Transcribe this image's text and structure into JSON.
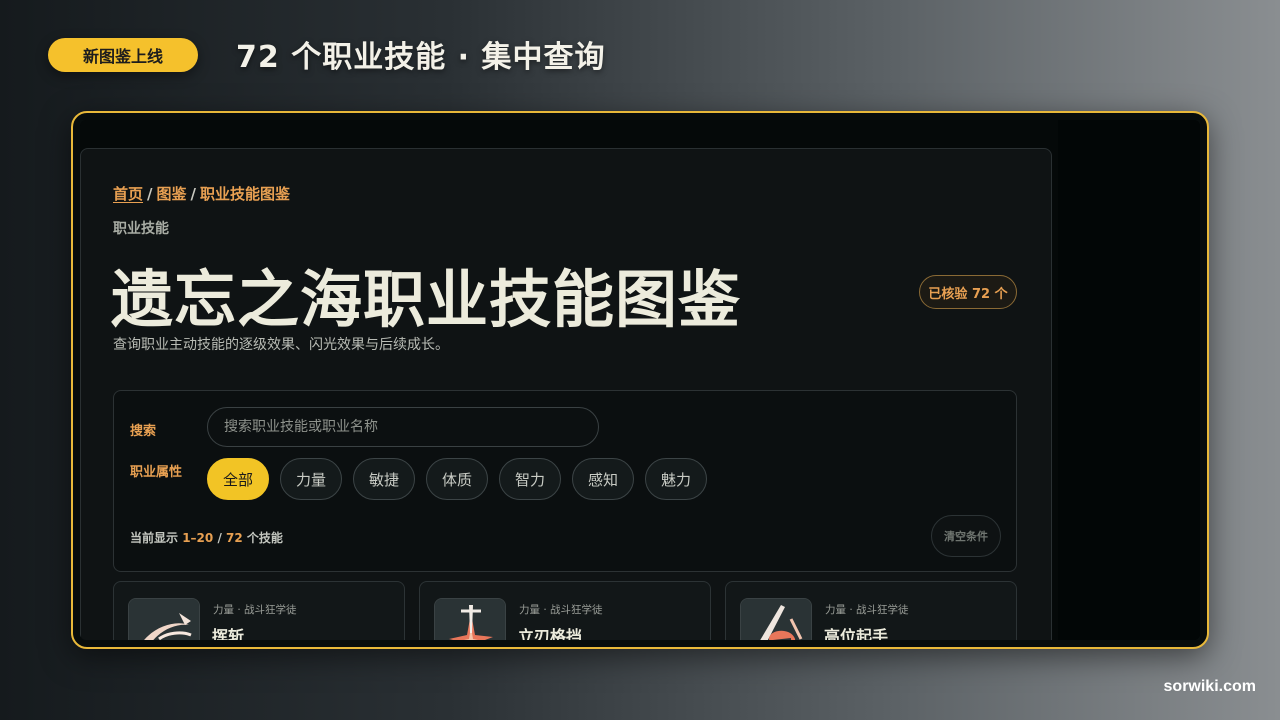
{
  "promo": {
    "badge": "新图鉴上线",
    "title": "72 个职业技能 · 集中查询"
  },
  "breadcrumb": {
    "home": "首页",
    "sep": "/",
    "encyclopedia": "图鉴",
    "current": "职业技能图鉴"
  },
  "page": {
    "eyebrow": "职业技能",
    "title": "遗忘之海职业技能图鉴",
    "verified_badge": "已核验 72 个",
    "lead": "查询职业主动技能的逐级效果、闪光效果与后续成长。"
  },
  "filters": {
    "search_label": "搜索",
    "search_placeholder": "搜索职业技能或职业名称",
    "search_value": "",
    "attr_label": "职业属性",
    "chips": [
      "全部",
      "力量",
      "敏捷",
      "体质",
      "智力",
      "感知",
      "魅力"
    ],
    "active_chip": "全部",
    "result_prefix": "当前显示",
    "result_range": "1–20",
    "result_sep": "/",
    "result_total": "72",
    "result_suffix": "个技能",
    "clear_label": "清空条件"
  },
  "cards": [
    {
      "meta": "力量 · 战斗狂学徒",
      "name": "挥斩",
      "icon": "slash-swirl-icon"
    },
    {
      "meta": "力量 · 战斗狂学徒",
      "name": "立刃格挡",
      "icon": "blade-parry-icon"
    },
    {
      "meta": "力量 · 战斗狂学徒",
      "name": "高位起手",
      "icon": "raised-fist-icon"
    }
  ],
  "watermark": "sorwiki.com",
  "colors": {
    "accent": "#f2c425",
    "orange": "#e8a052",
    "frame_border": "#e9b93a",
    "panel_bg": "#0f1314"
  }
}
